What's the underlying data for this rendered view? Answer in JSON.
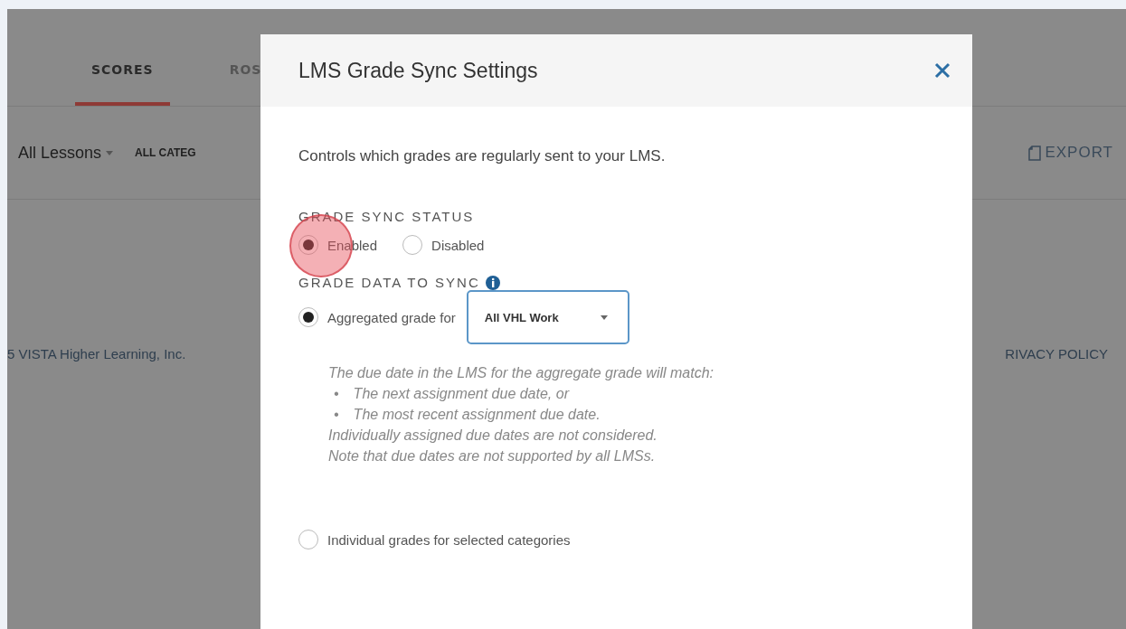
{
  "background": {
    "tabs": [
      {
        "label": "SCORES",
        "selected": true
      },
      {
        "label": "ROS",
        "selected": false
      }
    ],
    "lesson_filter": "All Lessons",
    "category_filter": "ALL CATEG",
    "export_button": "EXPORT",
    "footer_left": "5 VISTA Higher Learning, Inc.",
    "footer_right": "RIVACY POLICY"
  },
  "dialog": {
    "title": "LMS Grade Sync Settings",
    "description": "Controls which grades are regularly sent to your LMS.",
    "status": {
      "heading": "GRADE SYNC STATUS",
      "options": [
        {
          "label": "Enabled",
          "selected": true
        },
        {
          "label": "Disabled",
          "selected": false
        }
      ]
    },
    "data": {
      "heading": "GRADE DATA TO SYNC",
      "options": [
        {
          "kind": "select",
          "label": "Aggregated grade for",
          "selected": true,
          "select_value": "All VHL Work",
          "note_intro": "The due date in the LMS for the aggregate grade will match:",
          "bullet": "•",
          "bullets": [
            "The next assignment due date, or",
            "The most recent assignment due date."
          ],
          "note_lines": [
            "Individually assigned due dates are not considered.",
            "Note that due dates are not supported by all LMSs."
          ]
        },
        {
          "kind": "plain",
          "label": "Individual grades for selected categories",
          "selected": false
        }
      ]
    }
  }
}
